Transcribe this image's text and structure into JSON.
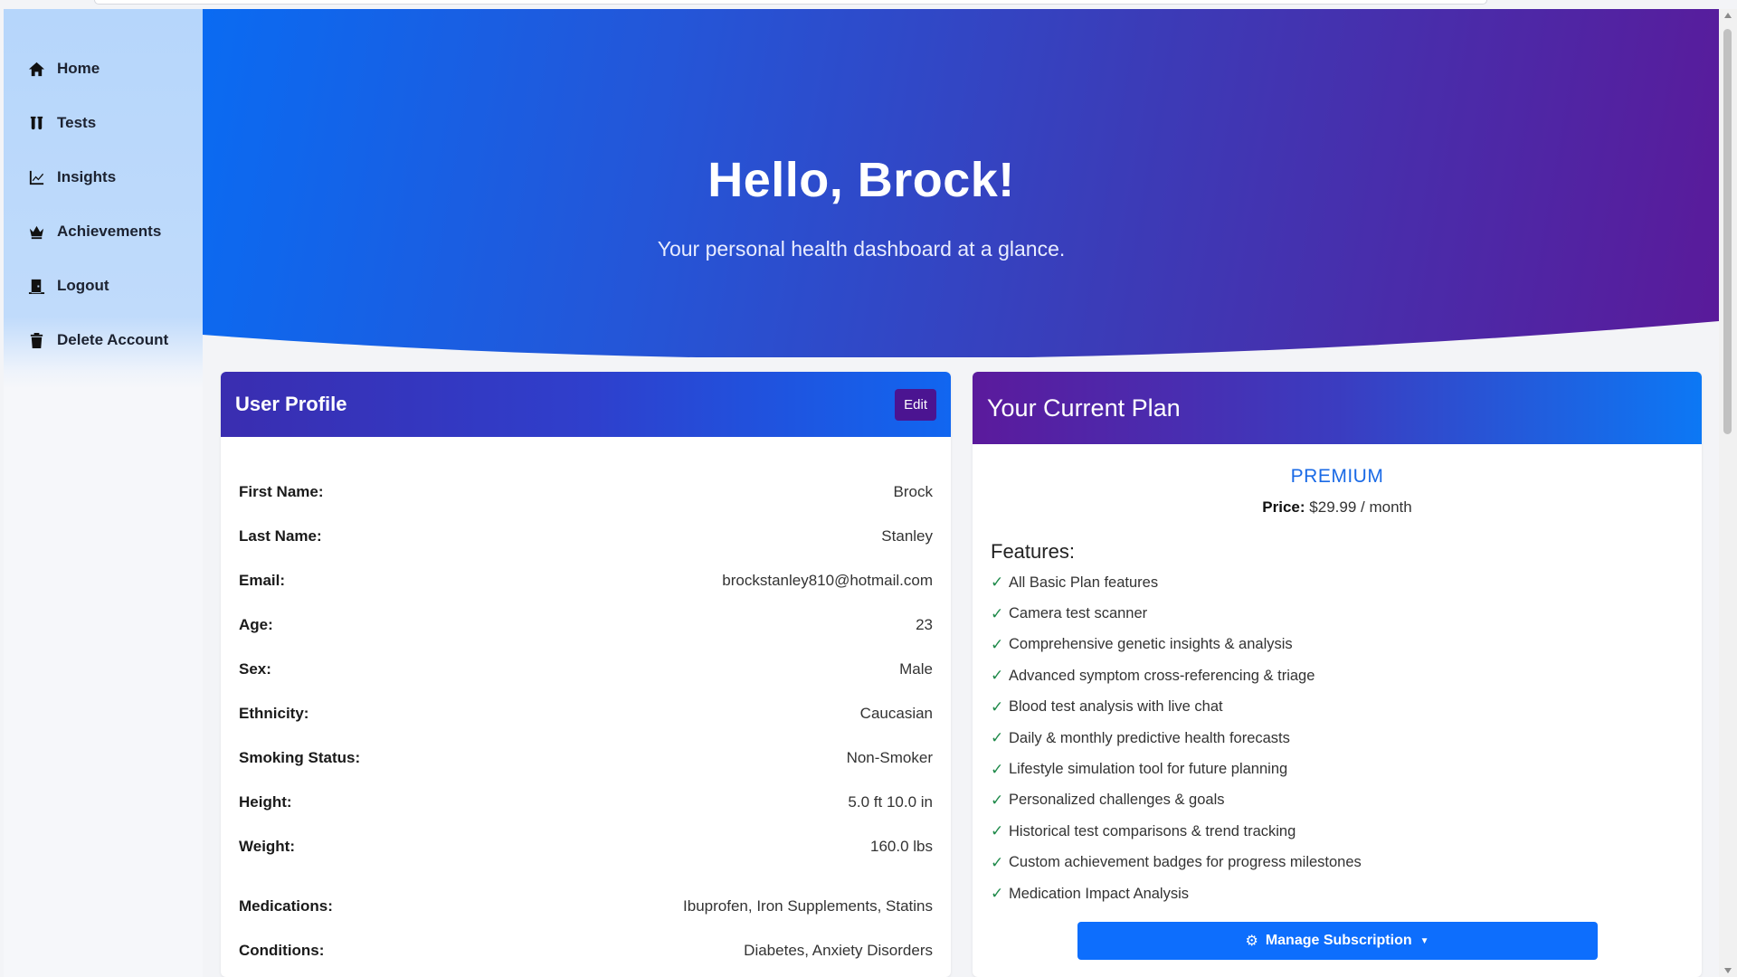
{
  "sidebar": {
    "items": [
      {
        "label": "Home",
        "icon": "home-icon"
      },
      {
        "label": "Tests",
        "icon": "test-tubes-icon"
      },
      {
        "label": "Insights",
        "icon": "line-chart-icon"
      },
      {
        "label": "Achievements",
        "icon": "crown-icon"
      },
      {
        "label": "Logout",
        "icon": "door-icon"
      },
      {
        "label": "Delete Account",
        "icon": "trash-icon"
      }
    ]
  },
  "hero": {
    "title": "Hello, Brock!",
    "subtitle": "Your personal health dashboard at a glance."
  },
  "profile": {
    "title": "User Profile",
    "edit_label": "Edit",
    "rows": [
      {
        "label": "First Name:",
        "value": "Brock"
      },
      {
        "label": "Last Name:",
        "value": "Stanley"
      },
      {
        "label": "Email:",
        "value": "brockstanley810@hotmail.com"
      },
      {
        "label": "Age:",
        "value": "23"
      },
      {
        "label": "Sex:",
        "value": "Male"
      },
      {
        "label": "Ethnicity:",
        "value": "Caucasian"
      },
      {
        "label": "Smoking Status:",
        "value": "Non-Smoker"
      },
      {
        "label": "Height:",
        "value": "5.0 ft 10.0 in"
      },
      {
        "label": "Weight:",
        "value": "160.0 lbs"
      },
      {
        "label": "Medications:",
        "value": "Ibuprofen, Iron Supplements, Statins"
      },
      {
        "label": "Conditions:",
        "value": "Diabetes, Anxiety Disorders"
      }
    ]
  },
  "plan": {
    "title": "Your Current Plan",
    "name": "PREMIUM",
    "price_label": "Price:",
    "price_value": "$29.99 / month",
    "features_title": "Features:",
    "features": [
      "All Basic Plan features",
      "Camera test scanner",
      "Comprehensive genetic insights & analysis",
      "Advanced symptom cross-referencing & triage",
      "Blood test analysis with live chat",
      "Daily & monthly predictive health forecasts",
      "Lifestyle simulation tool for future planning",
      "Personalized challenges & goals",
      "Historical test comparisons & trend tracking",
      "Custom achievement badges for progress milestones",
      "Medication Impact Analysis"
    ],
    "manage_label": "Manage Subscription"
  },
  "colors": {
    "accent": "#0d6efd",
    "plan_name": "#1a6ae6",
    "check": "#1f8a4a",
    "edit_button": "#4b1491"
  }
}
